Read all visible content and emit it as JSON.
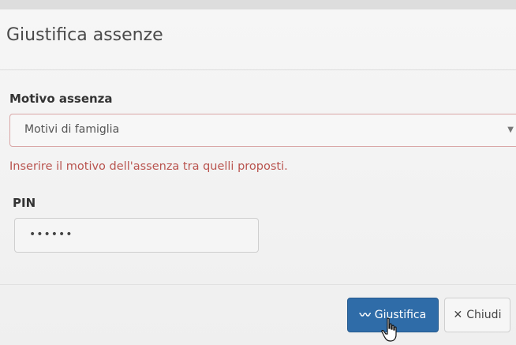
{
  "dialog": {
    "title": "Giustifica assenze",
    "reason": {
      "label": "Motivo assenza",
      "selected": "Motivi di famiglia",
      "help": "Inserire il motivo dell'assenza tra quelli proposti."
    },
    "pin": {
      "label": "PIN",
      "masked_value": "••••••"
    },
    "buttons": {
      "justify": "Giustifica",
      "close": "Chiudi"
    }
  },
  "colors": {
    "primary": "#2f6ca8",
    "error": "#b9544f",
    "error_border": "#d9a6a6"
  },
  "icons": {
    "justify": "signature-icon",
    "close": "close-icon",
    "caret": "caret-down-icon",
    "pointer": "hand-pointer-icon"
  }
}
